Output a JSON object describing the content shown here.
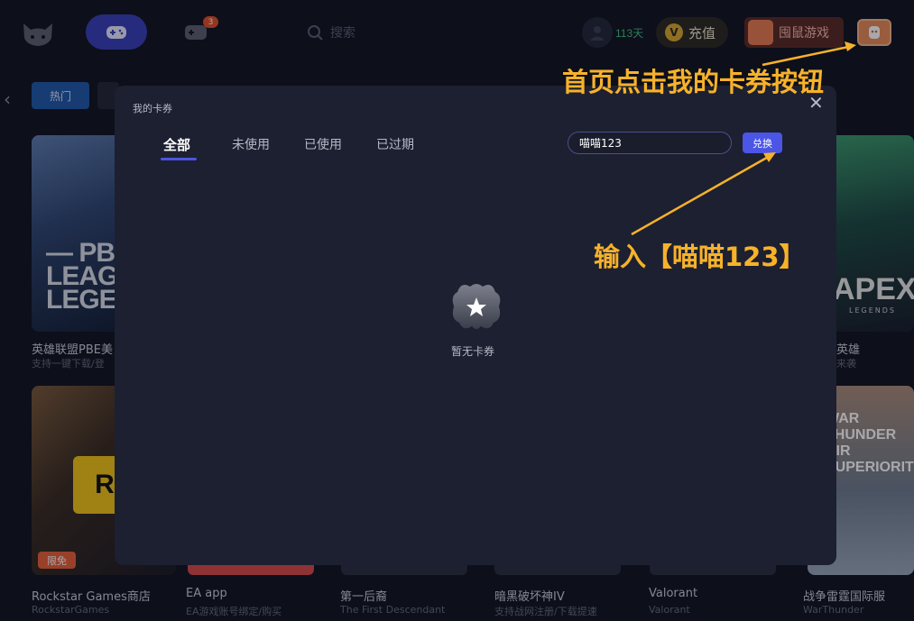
{
  "topbar": {
    "home_icon": "gamepad-icon",
    "games_badge": "3",
    "search_placeholder": "搜索",
    "days": "113天",
    "recharge_label": "充值",
    "game_label": "囤鼠游戏"
  },
  "filters": {
    "hot_label": "热门"
  },
  "cards_row1": [
    {
      "title": "英雄联盟PBE美",
      "sub": "支持一键下载/登",
      "art_text": "— PBE\nLEAGU\nLEGEN"
    },
    {
      "title": "英雄",
      "sub": "来袭",
      "art_text": "APEX",
      "art_sub": "LEGENDS"
    }
  ],
  "cards_row2": [
    {
      "title": "Rockstar Games商店",
      "sub": "RockstarGames",
      "tag": "限免",
      "logo": "R"
    },
    {
      "title": "EA app",
      "sub": "EA游戏账号绑定/购买"
    },
    {
      "title": "第一后裔",
      "sub": "The First Descendant"
    },
    {
      "title": "暗黑破坏神IV",
      "sub": "支持战网注册/下载提速"
    },
    {
      "title": "Valorant",
      "sub": "Valorant"
    },
    {
      "title": "战争雷霆国际服",
      "sub": "WarThunder",
      "art_text": "WAR\nTHUNDER\nAIR\nSUPERIORITY"
    }
  ],
  "modal": {
    "title": "我的卡券",
    "close": "✕",
    "tabs": [
      "全部",
      "未使用",
      "已使用",
      "已过期"
    ],
    "code_value": "喵喵123",
    "redeem_label": "兑换",
    "empty_text": "暂无卡券"
  },
  "annotations": {
    "note1": "首页点击我的卡券按钮",
    "note2": "输入【喵喵123】"
  },
  "colors": {
    "background": "#121522",
    "modal": "#1d2030",
    "accent": "#4b55e6",
    "annotation": "#f7b22a"
  }
}
